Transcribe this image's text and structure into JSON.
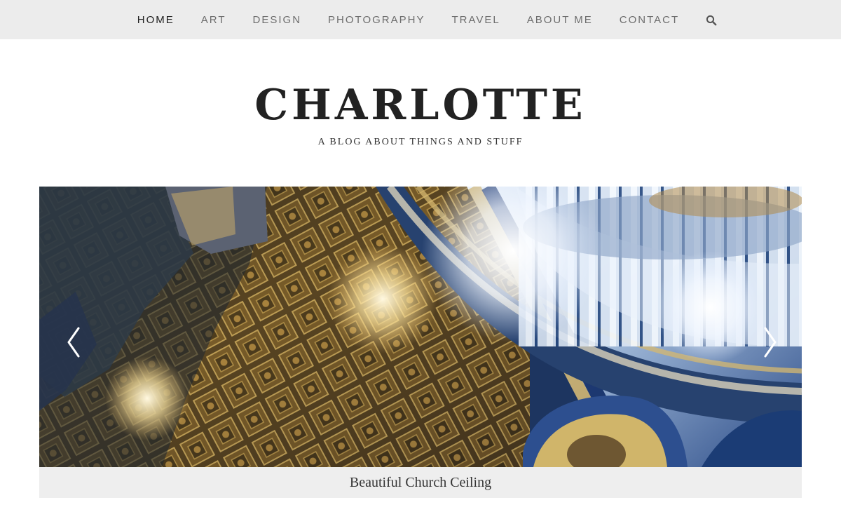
{
  "nav": {
    "items": [
      {
        "label": "HOME",
        "active": true
      },
      {
        "label": "ART",
        "active": false
      },
      {
        "label": "DESIGN",
        "active": false
      },
      {
        "label": "PHOTOGRAPHY",
        "active": false
      },
      {
        "label": "TRAVEL",
        "active": false
      },
      {
        "label": "ABOUT ME",
        "active": false
      },
      {
        "label": "CONTACT",
        "active": false
      }
    ],
    "search_icon": "search-icon",
    "background_color": "#ececec",
    "active_color": "#222222",
    "inactive_color": "#6d6d6d"
  },
  "site": {
    "title": "CHARLOTTE",
    "tagline": "A BLOG ABOUT THINGS AND STUFF"
  },
  "slider": {
    "caption": "Beautiful Church Ceiling",
    "prev_icon": "chevron-left-icon",
    "next_icon": "chevron-right-icon",
    "caption_background": "#eeeeee"
  }
}
